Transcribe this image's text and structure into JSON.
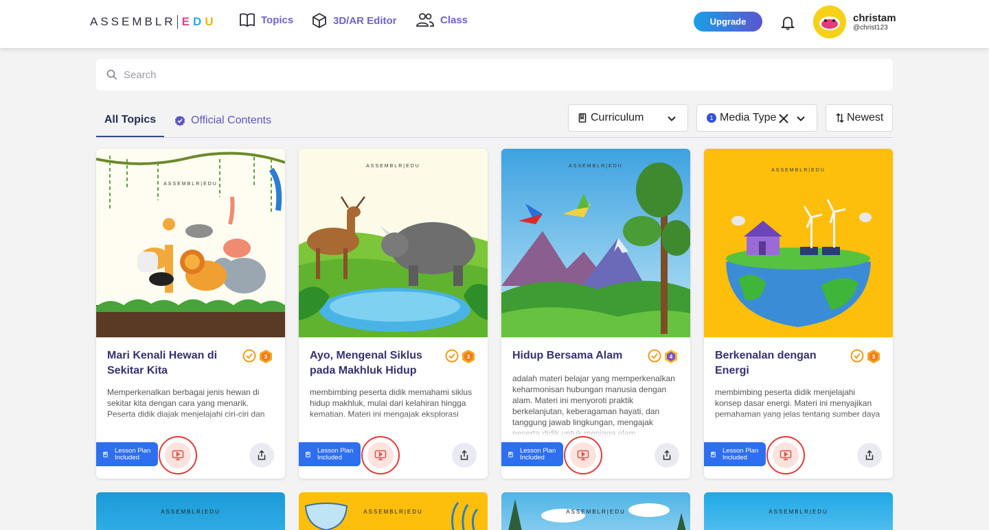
{
  "header": {
    "logo_main": "ASSEMBLR",
    "logo_edu": [
      "E",
      "D",
      "U"
    ],
    "nav": {
      "topics": "Topics",
      "editor": "3D/AR Editor",
      "class": "Class"
    },
    "upgrade": "Upgrade",
    "user": {
      "name": "christam",
      "handle": "@christ123"
    }
  },
  "search": {
    "placeholder": "Search"
  },
  "tabs": {
    "all": "All Topics",
    "official": "Official Contents"
  },
  "filters": {
    "curriculum": "Curriculum",
    "media_type": "Media Type",
    "media_count": "1",
    "sort": "Newest"
  },
  "cards": [
    {
      "title": "Mari Kenali Hewan di Sekitar Kita",
      "level": "3",
      "brand": "ASSEMBLR|EDU",
      "desc": "Memperkenalkan berbagai jenis hewan di sekitar kita dengan cara yang menarik. Peserta didik diajak menjelajahi ciri-ciri dan peran ekologis hewan, meningkatkan pemahaman mereka.",
      "lesson": "Lesson Plan Included"
    },
    {
      "title": "Ayo, Mengenal Siklus pada Makhluk Hidup",
      "level": "3",
      "brand": "ASSEMBLR|EDU",
      "desc": "membimbing peserta didik memahami siklus hidup makhluk, mulai dari kelahiran hingga kematian. Materi ini mengajak eksplorasi tentang pertumbuhan, perkembangan, dan reproduksi.",
      "lesson": "Lesson Plan Included"
    },
    {
      "title": "Hidup Bersama Alam",
      "level": "4",
      "brand": "ASSEMBLR|EDU",
      "desc": "adalah materi belajar yang memperkenalkan keharmonisan hubungan manusia dengan alam. Materi ini menyoroti praktik berkelanjutan, keberagaman hayati, dan tanggung jawab lingkungan, mengajak peserta didik untuk menjaga alam.",
      "lesson": "Lesson Plan Included"
    },
    {
      "title": "Berkenalan dengan Energi",
      "level": "3",
      "brand": "ASSEMBLR|EDU",
      "desc": "membimbing peserta didik menjelajahi konsep dasar energi. Materi ini menyajikan pemahaman yang jelas tentang sumber daya energi, transformasi, dan peran energi dalam kehidupan.",
      "lesson": "Lesson Plan Included"
    }
  ],
  "row2_brand": "ASSEMBLR|EDU",
  "colors": {
    "accent": "#6d63c9",
    "title": "#35306f",
    "lesson": "#2e6ff0",
    "highlight": "#e53834",
    "level_orange": "#f07b1d",
    "level_purple": "#7a4fd1"
  }
}
